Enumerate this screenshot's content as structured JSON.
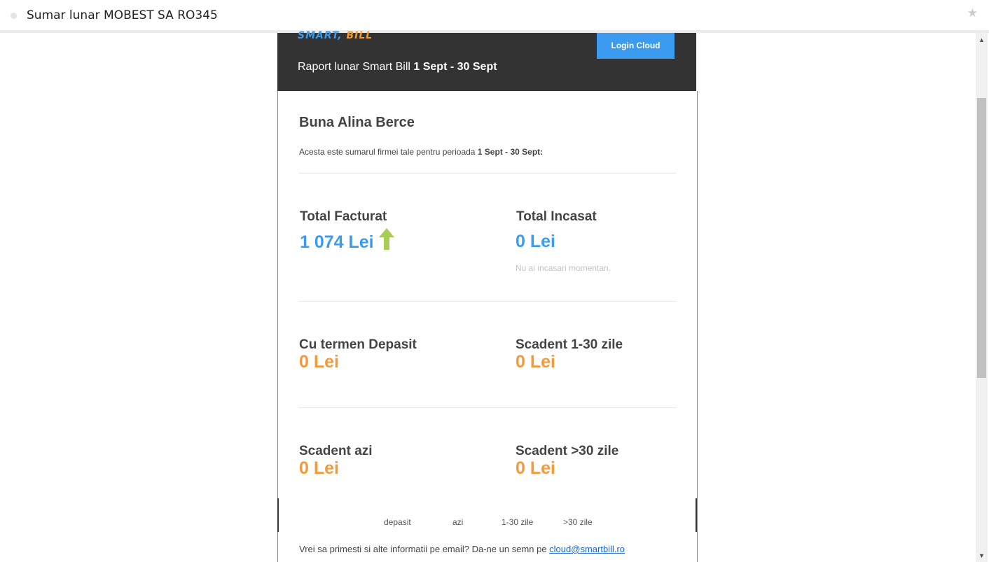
{
  "window": {
    "subject": "Sumar lunar MOBEST SA RO345"
  },
  "header": {
    "logo_smart": "SMART,",
    "logo_bill": "BILL",
    "login_label": "Login Cloud",
    "report_prefix": "Raport lunar Smart Bill ",
    "report_period": "1 Sept - 30 Sept"
  },
  "body": {
    "greeting": "Buna Alina Berce",
    "summary_prefix": "Acesta este sumarul firmei tale pentru perioada ",
    "summary_period": "1 Sept - 30 Sept:"
  },
  "metrics": {
    "total_facturat": {
      "label": "Total Facturat",
      "value": "1 074 Lei",
      "trend": "up"
    },
    "total_incasat": {
      "label": "Total Incasat",
      "value": "0 Lei",
      "note": "Nu ai incasari momentan."
    },
    "termen_depasit": {
      "label": "Cu termen Depasit",
      "value": "0 Lei"
    },
    "scadent_1_30": {
      "label": "Scadent 1-30 zile",
      "value": "0 Lei"
    },
    "scadent_azi": {
      "label": "Scadent azi",
      "value": "0 Lei"
    },
    "scadent_30": {
      "label": "Scadent >30 zile",
      "value": "0 Lei"
    }
  },
  "legend": {
    "items": [
      "depasit",
      "azi",
      "1-30 zile",
      ">30 zile"
    ]
  },
  "footer": {
    "text": "Vrei sa primesti si alte informatii pe email? Da-ne un semn pe ",
    "email": "cloud@smartbill.ro"
  },
  "colors": {
    "accent_blue": "#3a9bf0",
    "accent_orange": "#f39a3c",
    "header_dark": "#333333",
    "trend_green": "#a9cc55"
  }
}
